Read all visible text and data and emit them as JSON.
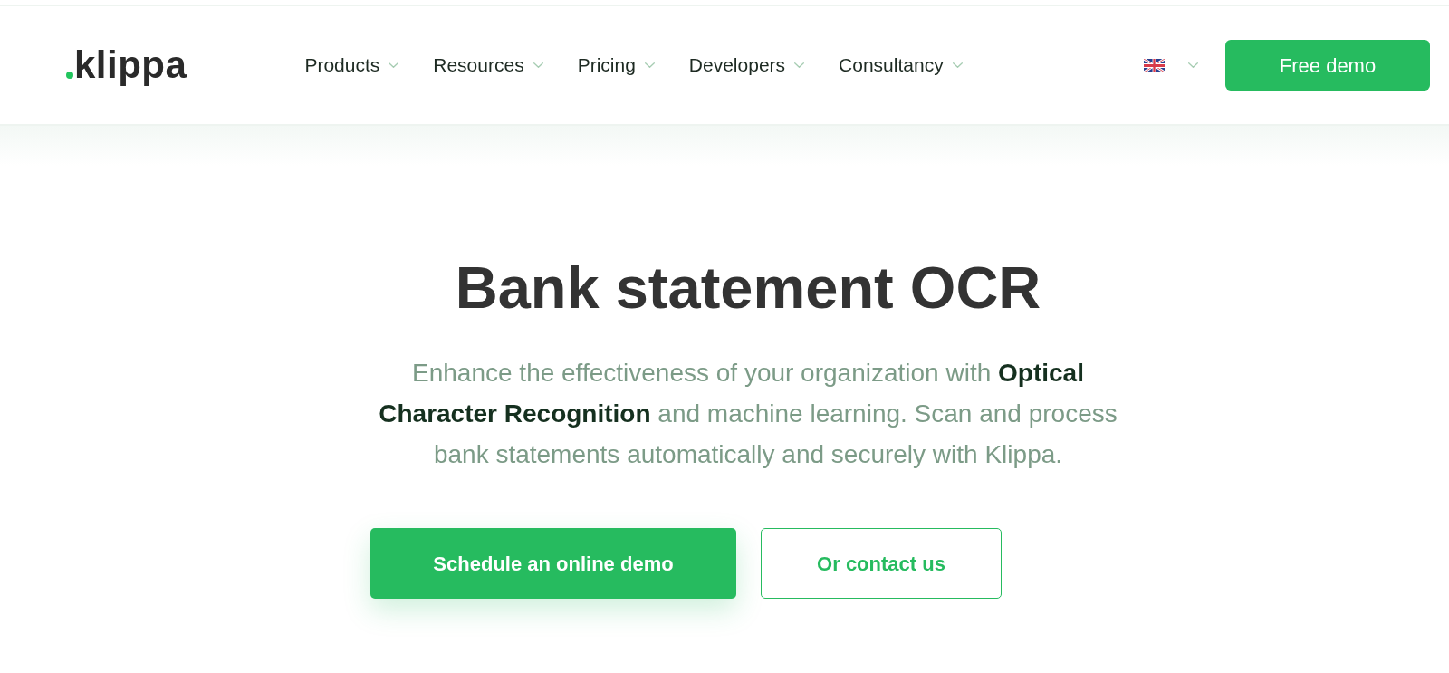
{
  "header": {
    "logo": {
      "text": "klippa"
    },
    "nav": [
      {
        "label": "Products",
        "dropdown": true
      },
      {
        "label": "Resources",
        "dropdown": true
      },
      {
        "label": "Pricing",
        "dropdown": true
      },
      {
        "label": "Developers",
        "dropdown": true
      },
      {
        "label": "Consultancy",
        "dropdown": true
      }
    ],
    "language_menu": {
      "dropdown": true
    },
    "cta": {
      "label": "Free demo"
    }
  },
  "hero": {
    "title": "Bank statement OCR",
    "text": "Enhance the effectiveness of your organization with **Optical Character Recognition** and machine learning. Scan and process bank statements automatically and securely with Klippa.",
    "buttons": [
      {
        "label": "Schedule an online demo",
        "kind": "primary"
      },
      {
        "label": "Or contact us",
        "kind": "outline"
      }
    ]
  }
}
